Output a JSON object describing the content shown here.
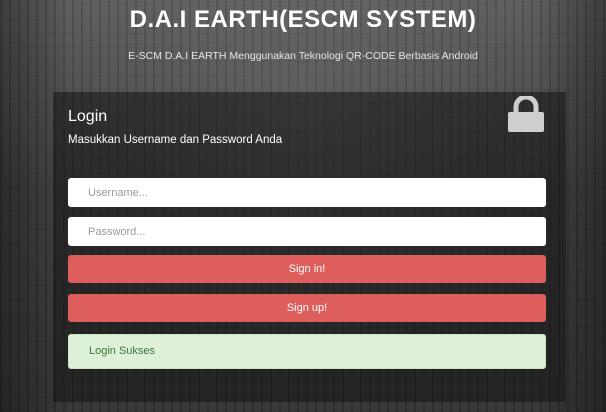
{
  "header": {
    "title": "D.A.I EARTH(ESCM SYSTEM)",
    "subtitle": "E-SCM D.A.I EARTH Menggunakan Teknologi QR-CODE Berbasis Android"
  },
  "login": {
    "title": "Login",
    "instruction": "Masukkan Username dan Password Anda",
    "lock_icon": "lock-icon",
    "username": {
      "value": "",
      "placeholder": "Username..."
    },
    "password": {
      "value": "",
      "placeholder": "Password..."
    },
    "signin_label": "Sign in!",
    "signup_label": "Sign up!",
    "status_message": "Login Sukses"
  },
  "colors": {
    "button": "#de5e5c",
    "success_bg": "#dff0d8",
    "success_text": "#3c763d",
    "panel": "#141414"
  }
}
